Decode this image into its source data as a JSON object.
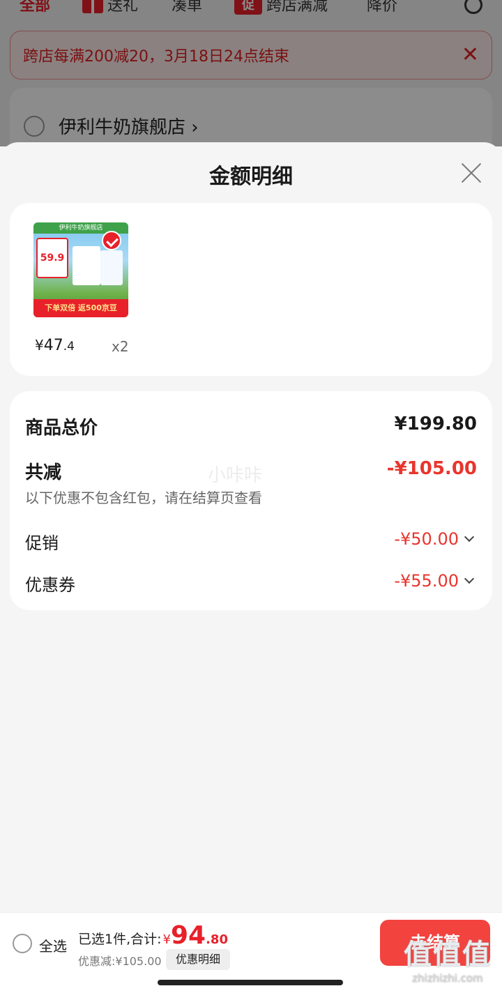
{
  "tabs": [
    {
      "label": "全部"
    },
    {
      "label": "送礼"
    },
    {
      "label": "凑单"
    },
    {
      "label": "跨店满减",
      "badge": "促"
    },
    {
      "label": "降价"
    }
  ],
  "banner": {
    "text": "跨店每满200减20，3月18日24点结束"
  },
  "store": {
    "name": "伊利牛奶旗舰店 ›"
  },
  "sheet": {
    "title": "金额明细"
  },
  "product": {
    "image_top_text": "伊利牛奶旗舰店",
    "image_tag_text": "59.9",
    "image_bottom_text": "下单双倍 返500京豆",
    "price_currency": "¥",
    "price_int": "47",
    "price_dec": ".4",
    "qty": "x2"
  },
  "details": {
    "total_label": "商品总价",
    "total_value": "¥199.80",
    "reduce_label": "共减",
    "reduce_value": "-¥105.00",
    "note": "以下优惠不包含红包，请在结算页查看",
    "promo_label": "促销",
    "promo_value": "-¥50.00",
    "coupon_label": "优惠券",
    "coupon_value": "-¥55.00",
    "watermark": "小咔咔"
  },
  "bottom": {
    "select_all": "全选",
    "summary_text": "已选1件,合计:",
    "summary_currency": "¥",
    "summary_int": "94",
    "summary_dec": ".80",
    "discount_text": "优惠减:¥105.00",
    "detail_button": "优惠明细",
    "checkout_button": "去结算"
  },
  "site": {
    "logo": "值值值",
    "url": "zhizhizhi.com"
  },
  "colors": {
    "accent": "#e8202a",
    "discount": "#e8352d",
    "checkout": "#f2433f"
  }
}
